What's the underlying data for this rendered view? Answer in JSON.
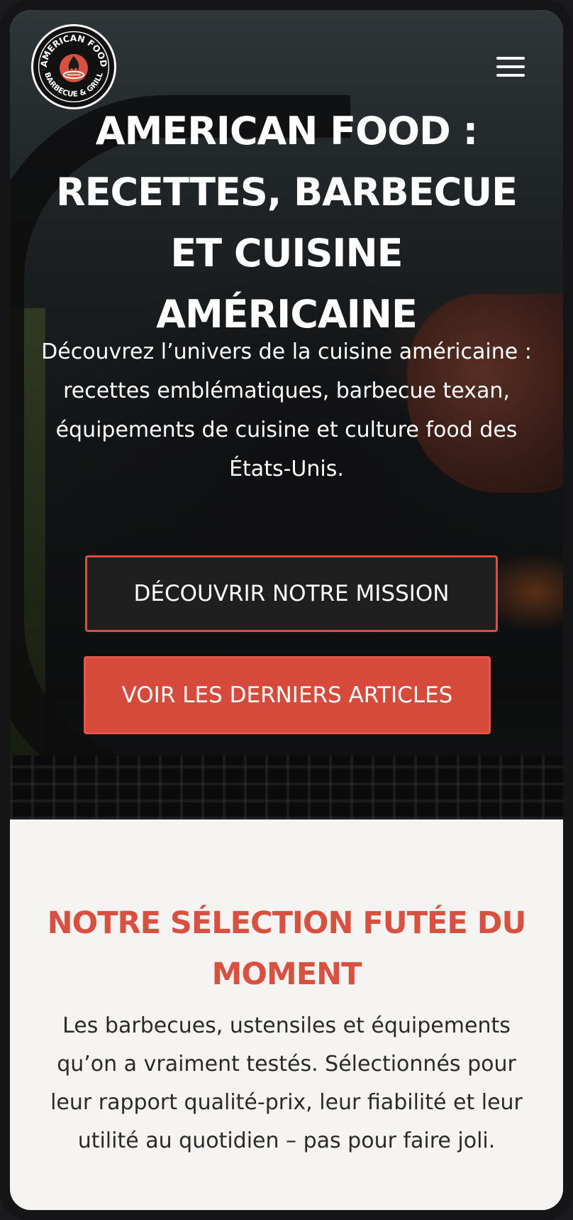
{
  "logo": {
    "top_text": "AMERICAN FOOD",
    "bottom_text": "BARBECUE & GRILL"
  },
  "header": {
    "menu_icon": "hamburger-menu-icon"
  },
  "hero": {
    "title": "American Food : Recettes, Barbecue et Cuisine Américaine",
    "description": "Découvrez l’univers de la cuisine américaine : recettes emblématiques, barbecue texan, équipements de cuisine et culture food des États-Unis.",
    "primary_button": "Découvrir notre mission",
    "secondary_button": "Voir les derniers articles"
  },
  "selection": {
    "title": "Notre sélection futée du moment",
    "description": "Les barbecues, ustensiles et équipements qu’on a vraiment testés. Sélectionnés pour leur rapport qualité-prix, leur fiabilité et leur utilité au quotidien – pas pour faire joli."
  },
  "colors": {
    "accent": "#d85040",
    "button_dark": "#1f1f1f",
    "section_bg": "#f6f4f2",
    "text_dark": "#2a2a2a"
  }
}
